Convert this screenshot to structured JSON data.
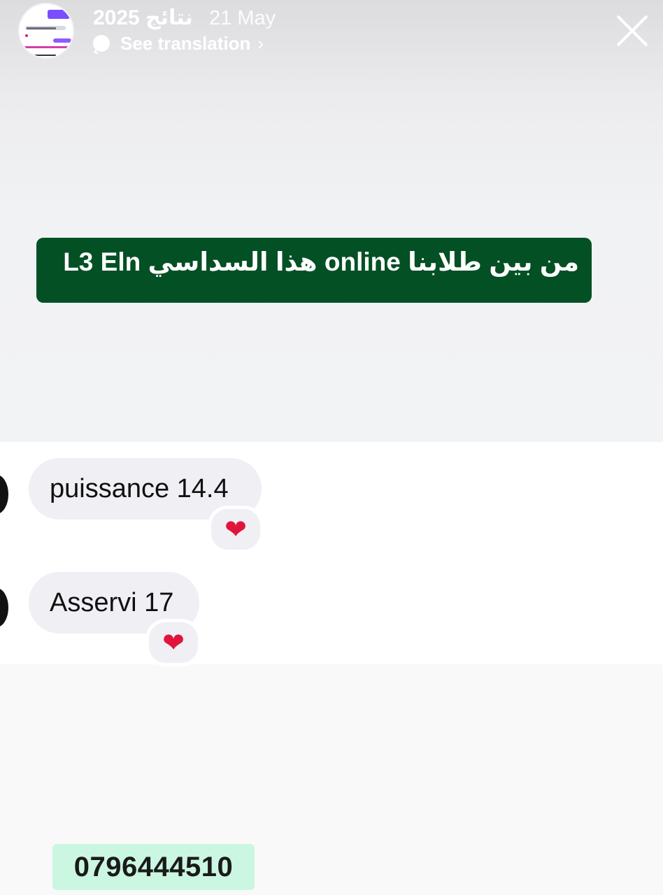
{
  "header": {
    "title": "نتائج 2025",
    "date": "21 May",
    "see_translation": "See translation",
    "chevron": "›"
  },
  "story": {
    "banner_text": "من بين طلابنا online هذا السداسي L3 Eln"
  },
  "messages": [
    {
      "text": "puissance 14.4",
      "reaction": "❤"
    },
    {
      "text": "Asservi 17",
      "reaction": "❤"
    }
  ],
  "phone": "0796444510",
  "colors": {
    "banner": "#035025",
    "phone_box": "#cbf6e1",
    "heart": "#e0153c",
    "bubble": "#efeff4"
  },
  "icons": {
    "close": "close-icon",
    "translation": "speech-bubble-icon",
    "reaction": "red-heart-icon"
  }
}
